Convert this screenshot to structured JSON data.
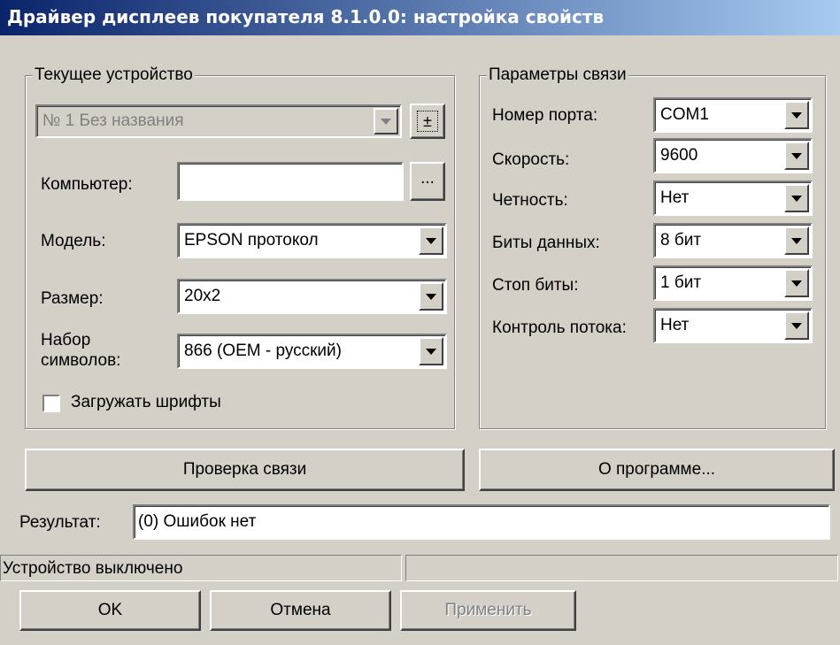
{
  "window": {
    "title": "Драйвер дисплеев покупателя 8.1.0.0: настройка свойств"
  },
  "device": {
    "group_label": "Текущее устройство",
    "selector_value": "№ 1 Без названия",
    "plus_minus_label": "±",
    "computer_label": "Компьютер:",
    "computer_value": "",
    "browse_label": "...",
    "model_label": "Модель:",
    "model_value": "EPSON протокол",
    "size_label": "Размер:",
    "size_value": "20x2",
    "charset_label_line1": "Набор",
    "charset_label_line2": "символов:",
    "charset_value": "866 (OEM - русский)",
    "load_fonts_label": "Загружать шрифты",
    "load_fonts_checked": false
  },
  "connection": {
    "group_label": "Параметры связи",
    "fields": [
      {
        "label": "Номер порта:",
        "value": "COM1"
      },
      {
        "label": "Скорость:",
        "value": "9600"
      },
      {
        "label": "Четность:",
        "value": "Нет"
      },
      {
        "label": "Биты данных:",
        "value": "8 бит"
      },
      {
        "label": "Стоп биты:",
        "value": "1 бит"
      },
      {
        "label": "Контроль потока:",
        "value": "Нет"
      }
    ]
  },
  "actions": {
    "check_label": "Проверка связи",
    "about_label": "О программе..."
  },
  "result": {
    "label": "Результат:",
    "value": "(0) Ошибок нет"
  },
  "status": {
    "text": "Устройство выключено",
    "text2": ""
  },
  "footer": {
    "ok_label": "OK",
    "cancel_label": "Отмена",
    "apply_label": "Применить"
  }
}
